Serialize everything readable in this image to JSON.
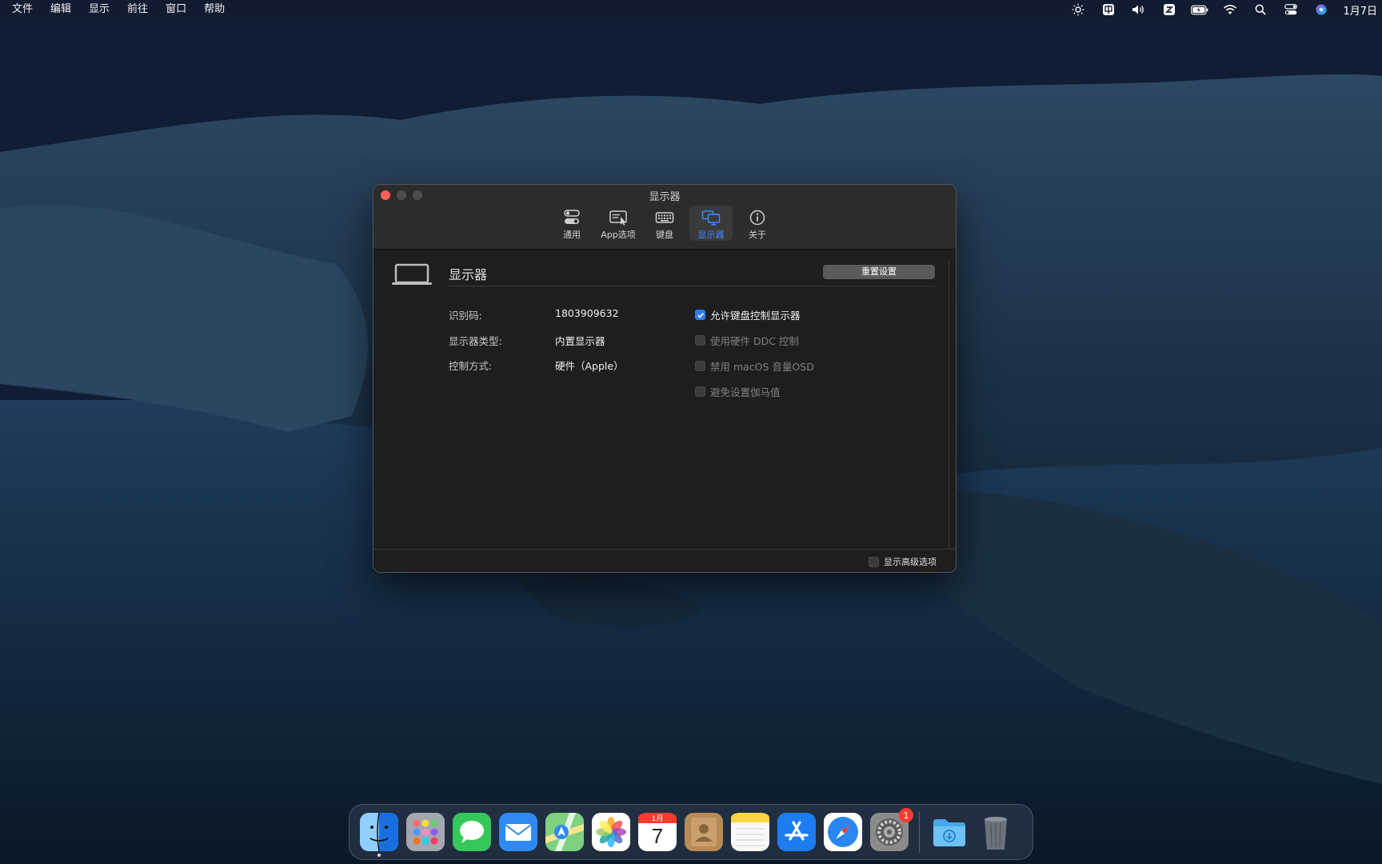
{
  "menubar": {
    "items": [
      "文件",
      "编辑",
      "显示",
      "前往",
      "窗口",
      "帮助"
    ],
    "clock": "1月7日"
  },
  "window": {
    "title": "显示器",
    "tabs": [
      {
        "label": "通用",
        "icon": "toggles-icon"
      },
      {
        "label": "App选项",
        "icon": "app-options-icon"
      },
      {
        "label": "键盘",
        "icon": "keyboard-icon"
      },
      {
        "label": "显示器",
        "icon": "displays-icon",
        "active": true
      },
      {
        "label": "关于",
        "icon": "info-icon"
      }
    ],
    "section_title": "显示器",
    "reset_button": "重置设置",
    "info": [
      {
        "label": "识别码:",
        "value": "1803909632"
      },
      {
        "label": "显示器类型:",
        "value": "内置显示器"
      },
      {
        "label": "控制方式:",
        "value": "硬件（Apple）"
      }
    ],
    "options": [
      {
        "label": "允许键盘控制显示器",
        "checked": true,
        "enabled": true
      },
      {
        "label": "使用硬件 DDC 控制",
        "checked": false,
        "enabled": false
      },
      {
        "label": "禁用 macOS 音量OSD",
        "checked": false,
        "enabled": false
      },
      {
        "label": "避免设置伽马值",
        "checked": false,
        "enabled": false
      }
    ],
    "footer_option": {
      "label": "显示高级选项",
      "checked": false
    }
  },
  "dock": {
    "apps": [
      {
        "name": "finder",
        "glyph": "☺",
        "color": "#2b8cf0",
        "running": true
      },
      {
        "name": "launchpad",
        "glyph": "▦",
        "color": "#8a8f99"
      },
      {
        "name": "messages",
        "glyph": "💬",
        "color": "#35c759"
      },
      {
        "name": "mail",
        "glyph": "✉",
        "color": "#2f8af5"
      },
      {
        "name": "maps",
        "glyph": "➤",
        "color": "#5cc16b"
      },
      {
        "name": "photos",
        "glyph": "✿",
        "color": "#f2f2f2"
      },
      {
        "name": "calendar",
        "glyph": "7",
        "color": "#ffffff",
        "month": "1月"
      },
      {
        "name": "contacts",
        "glyph": "👤",
        "color": "#b88a55"
      },
      {
        "name": "notes",
        "glyph": "≡",
        "color": "#f5f5f5"
      },
      {
        "name": "app-store",
        "glyph": "A",
        "color": "#1e7cf2"
      },
      {
        "name": "safari",
        "glyph": "⊘",
        "color": "#2a86f0"
      },
      {
        "name": "system-preferences",
        "glyph": "⚙",
        "color": "#8b8b8b",
        "badge": "1"
      },
      {
        "name": "downloads",
        "glyph": "⬇",
        "color": "#47a7e8"
      },
      {
        "name": "trash",
        "glyph": "🗑",
        "color": "#5f6670"
      }
    ]
  }
}
